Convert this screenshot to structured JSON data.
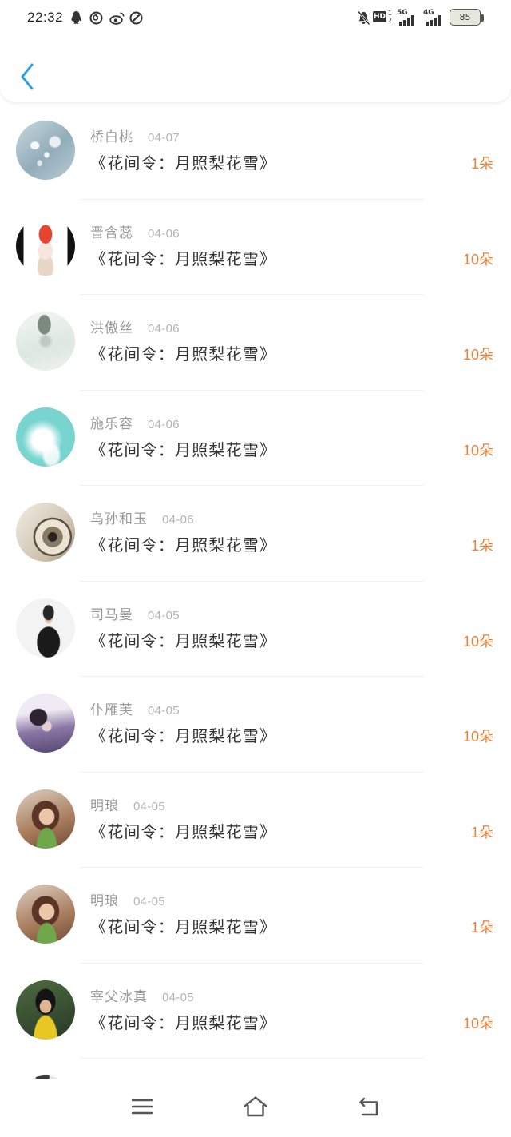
{
  "theme": {
    "accent": "#2b9fe3",
    "count_color": "#e8813a",
    "name_color": "#9a9a9a",
    "date_color": "#b3b3b3",
    "title_color": "#333333"
  },
  "status_bar": {
    "time": "22:32",
    "app_icons": [
      "qq-icon",
      "music-icon",
      "weibo-icon",
      "app-icon"
    ],
    "mute_icon": "bell-off-icon",
    "hd_label": "HD",
    "sim_labels": [
      "1",
      "2"
    ],
    "network_1": "5G",
    "network_2": "4G",
    "battery": "85"
  },
  "header": {
    "back_icon": "chevron-left-icon"
  },
  "list": {
    "items": [
      {
        "name": "桥白桃",
        "date": "04-07",
        "title": "《花间令：月照梨花雪》",
        "count": "1朵"
      },
      {
        "name": "晋含蕊",
        "date": "04-06",
        "title": "《花间令：月照梨花雪》",
        "count": "10朵"
      },
      {
        "name": "洪傲丝",
        "date": "04-06",
        "title": "《花间令：月照梨花雪》",
        "count": "10朵"
      },
      {
        "name": "施乐容",
        "date": "04-06",
        "title": "《花间令：月照梨花雪》",
        "count": "10朵"
      },
      {
        "name": "乌孙和玉",
        "date": "04-06",
        "title": "《花间令：月照梨花雪》",
        "count": "1朵"
      },
      {
        "name": "司马曼",
        "date": "04-05",
        "title": "《花间令：月照梨花雪》",
        "count": "10朵"
      },
      {
        "name": "仆雁芙",
        "date": "04-05",
        "title": "《花间令：月照梨花雪》",
        "count": "10朵"
      },
      {
        "name": "明琅",
        "date": "04-05",
        "title": "《花间令：月照梨花雪》",
        "count": "1朵"
      },
      {
        "name": "明琅",
        "date": "04-05",
        "title": "《花间令：月照梨花雪》",
        "count": "1朵"
      },
      {
        "name": "宰父冰真",
        "date": "04-05",
        "title": "《花间令：月照梨花雪》",
        "count": "10朵"
      }
    ]
  },
  "nav_bar": {
    "icons": [
      "menu-icon",
      "home-icon",
      "back-icon"
    ]
  }
}
